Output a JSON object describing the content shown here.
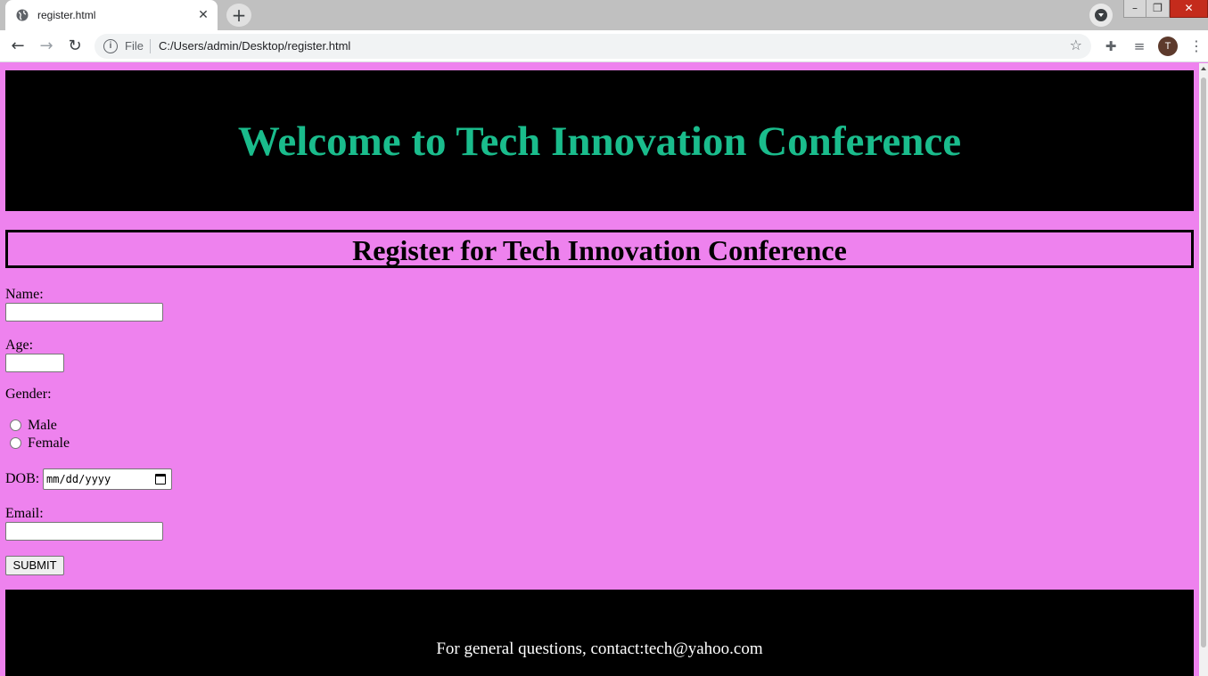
{
  "browser": {
    "tab_title": "register.html",
    "tab_close": "✕",
    "new_tab": "+",
    "scheme": "File",
    "url": "C:/Users/admin/Desktop/register.html",
    "profile_initial": "T"
  },
  "page": {
    "header_title": "Welcome to Tech Innovation Conference",
    "register_title": "Register for Tech Innovation Conference",
    "form": {
      "name_label": "Name:",
      "name_value": "",
      "age_label": "Age:",
      "age_value": "",
      "gender_label": "Gender:",
      "gender_options": [
        "Male",
        "Female"
      ],
      "dob_label": "DOB:",
      "dob_placeholder": "mm/dd/yyyy",
      "email_label": "Email:",
      "email_value": "",
      "submit_label": "SUBMIT"
    },
    "footer_text": "For general questions, contact:tech@yahoo.com"
  },
  "colors": {
    "page_background": "#ee82ee",
    "header_background": "#000000",
    "header_title": "#1abc8c",
    "footer_text": "#ffffff"
  }
}
